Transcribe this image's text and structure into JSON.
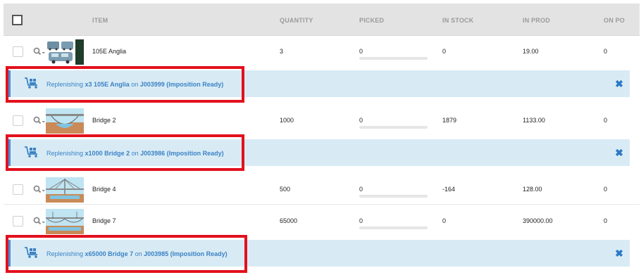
{
  "header": {
    "item": "ITEM",
    "quantity": "QUANTITY",
    "picked": "PICKED",
    "in_stock": "IN STOCK",
    "in_prod": "IN PROD",
    "on_po": "ON PO"
  },
  "rows": [
    {
      "item": "105E Anglia",
      "quantity": "3",
      "picked": "0",
      "in_stock": "0",
      "in_prod": "19.00",
      "on_po": "0"
    },
    {
      "item": "Bridge 2",
      "quantity": "1000",
      "picked": "0",
      "in_stock": "1879",
      "in_prod": "1133.00",
      "on_po": "0"
    },
    {
      "item": "Bridge 4",
      "quantity": "500",
      "picked": "0",
      "in_stock": "-164",
      "in_prod": "128.00",
      "on_po": "0"
    },
    {
      "item": "Bridge 7",
      "quantity": "65000",
      "picked": "0",
      "in_stock": "0",
      "in_prod": "390000.00",
      "on_po": "0"
    }
  ],
  "replenishments": [
    {
      "prefix": "Replenishing ",
      "qty_item": "x3 105E Anglia",
      "mid": " on ",
      "job": "J003999 (Imposition Ready)"
    },
    {
      "prefix": "Replenishing ",
      "qty_item": "x1000 Bridge 2",
      "mid": " on ",
      "job": "J003986 (Imposition Ready)"
    },
    {
      "prefix": "Replenishing ",
      "qty_item": "x65000 Bridge 7",
      "mid": " on ",
      "job": "J003985 (Imposition Ready)"
    }
  ],
  "icons": {
    "search": "magnifier-with-caret-icon",
    "cart": "trolley-cart-icon",
    "close": "x-close-icon"
  },
  "colors": {
    "header_bg": "#e3e3e3",
    "replenish_bg": "#d8ebf5",
    "replenish_accent": "#4a90d9",
    "link_blue": "#3b82c4",
    "highlight_red": "#e3101d"
  }
}
